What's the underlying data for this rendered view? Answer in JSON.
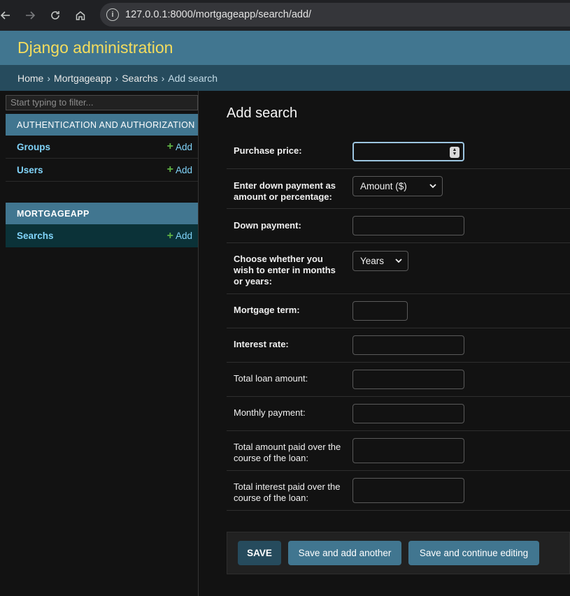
{
  "browser": {
    "url_host": "127.0.0.1",
    "url_rest": ":8000/mortgageapp/search/add/"
  },
  "header": {
    "site_name": "Django administration"
  },
  "breadcrumbs": {
    "home": "Home",
    "app": "Mortgageapp",
    "model": "Searchs",
    "current": "Add search",
    "separator": "›"
  },
  "sidebar": {
    "filter_placeholder": "Start typing to filter...",
    "modules": [
      {
        "caption": "AUTHENTICATION AND AUTHORIZATION",
        "models": [
          {
            "name": "Groups",
            "add": "Add"
          },
          {
            "name": "Users",
            "add": "Add"
          }
        ]
      },
      {
        "caption": "MORTGAGEAPP",
        "models": [
          {
            "name": "Searchs",
            "add": "Add"
          }
        ]
      }
    ]
  },
  "form": {
    "title": "Add search",
    "fields": {
      "purchase_price": {
        "label": "Purchase price:",
        "value": ""
      },
      "down_payment_type": {
        "label": "Enter down payment as amount or percentage:",
        "value": "Amount ($)"
      },
      "down_payment": {
        "label": "Down payment:",
        "value": ""
      },
      "term_unit": {
        "label": "Choose whether you wish to enter in months or years:",
        "value": "Years"
      },
      "mortgage_term": {
        "label": "Mortgage term:",
        "value": ""
      },
      "interest_rate": {
        "label": "Interest rate:",
        "value": ""
      },
      "total_loan": {
        "label": "Total loan amount:",
        "value": ""
      },
      "monthly_payment": {
        "label": "Monthly payment:",
        "value": ""
      },
      "total_paid": {
        "label": "Total amount paid over the course of the loan:",
        "value": ""
      },
      "total_interest": {
        "label": "Total interest paid over the course of the loan:",
        "value": ""
      }
    }
  },
  "submit": {
    "save": "SAVE",
    "save_add_another": "Save and add another",
    "save_continue": "Save and continue editing"
  },
  "colors": {
    "header_bg": "#417690",
    "site_name": "#f5dd5d",
    "breadcrumbs_bg": "#264b5d",
    "link": "#81d4fa",
    "add_plus": "#5fb344"
  }
}
